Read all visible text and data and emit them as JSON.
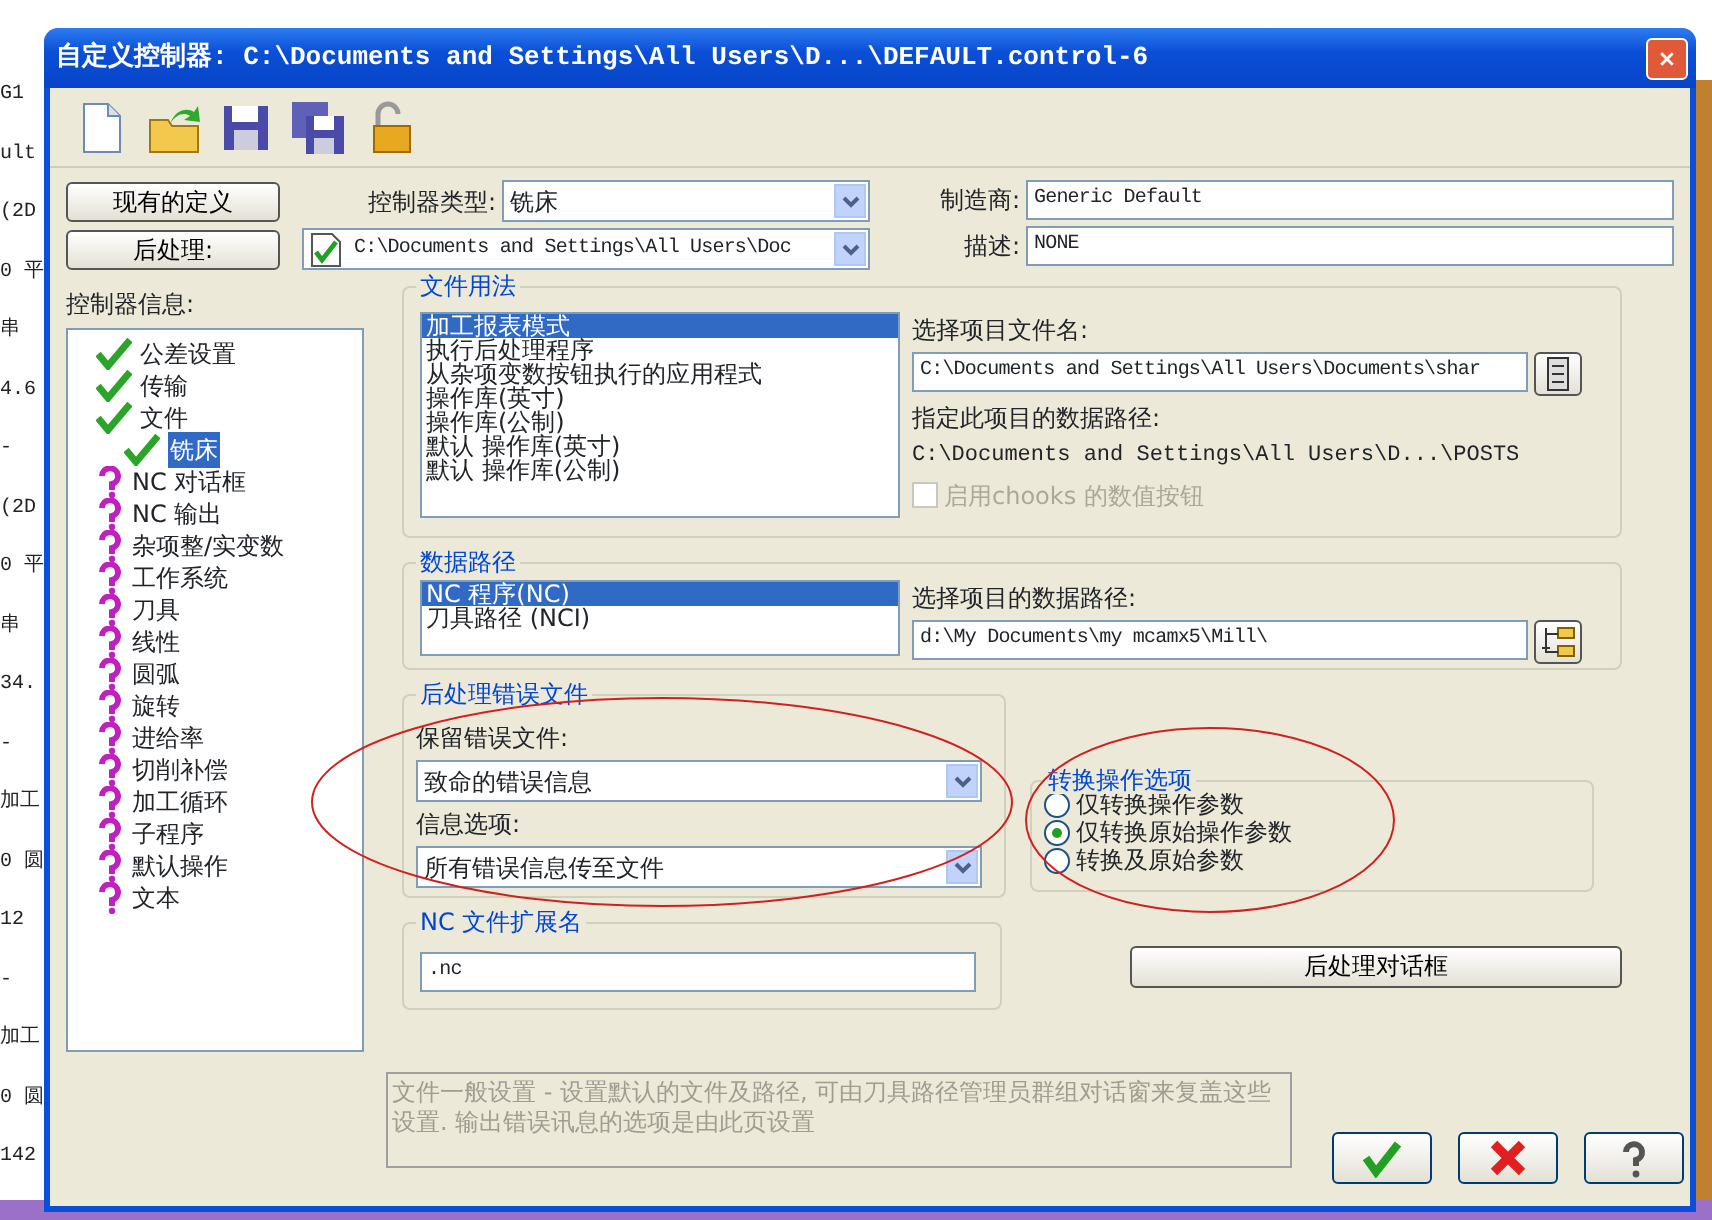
{
  "background_lines": [
    {
      "text": "G1"
    },
    {
      "text": "ult"
    },
    {
      "text": "(2D"
    },
    {
      "text": "0 平"
    },
    {
      "text": "串"
    },
    {
      "text": "4.6"
    },
    {
      "text": "-"
    },
    {
      "text": "(2D"
    },
    {
      "text": "0 平"
    },
    {
      "text": "串"
    },
    {
      "text": "34."
    },
    {
      "text": "-"
    },
    {
      "text": "加工"
    },
    {
      "text": "0 圆"
    },
    {
      "text": "12"
    },
    {
      "text": "-"
    },
    {
      "text": "加工"
    },
    {
      "text": "0 圆"
    },
    {
      "text": "142"
    }
  ],
  "window": {
    "title": "自定义控制器: C:\\Documents and Settings\\All Users\\D...\\DEFAULT.control-6"
  },
  "toolbar": [
    {
      "kind": "new"
    },
    {
      "kind": "open"
    },
    {
      "kind": "save"
    },
    {
      "kind": "saveas"
    },
    {
      "kind": "lock"
    }
  ],
  "existing_button": "现有的定义",
  "post_button": "后处理:",
  "controller_type": {
    "label": "控制器类型:",
    "value": "铣床"
  },
  "post_path": {
    "value": "C:\\Documents and Settings\\All Users\\Doc"
  },
  "manufacturer": {
    "label": "制造商:",
    "value": "Generic Default"
  },
  "description": {
    "label": "描述:",
    "value": "NONE"
  },
  "tree_label": "控制器信息:",
  "tree": [
    {
      "label": "公差设置",
      "kind": "done",
      "selected": false
    },
    {
      "label": "传输",
      "kind": "done",
      "selected": false
    },
    {
      "label": "文件",
      "kind": "done",
      "selected": false,
      "children": [
        {
          "label": "铣床",
          "kind": "done",
          "selected": true
        }
      ]
    },
    {
      "label": "NC 对话框",
      "kind": "todo",
      "selected": false
    },
    {
      "label": "NC 输出",
      "kind": "todo",
      "selected": false
    },
    {
      "label": "杂项整/实变数",
      "kind": "todo",
      "selected": false
    },
    {
      "label": "工作系统",
      "kind": "todo",
      "selected": false
    },
    {
      "label": "刀具",
      "kind": "todo",
      "selected": false
    },
    {
      "label": "线性",
      "kind": "todo",
      "selected": false
    },
    {
      "label": "圆弧",
      "kind": "todo",
      "selected": false
    },
    {
      "label": "旋转",
      "kind": "todo",
      "selected": false
    },
    {
      "label": "进给率",
      "kind": "todo",
      "selected": false
    },
    {
      "label": "切削补偿",
      "kind": "todo",
      "selected": false
    },
    {
      "label": "加工循环",
      "kind": "todo",
      "selected": false
    },
    {
      "label": "子程序",
      "kind": "todo",
      "selected": false
    },
    {
      "label": "默认操作",
      "kind": "todo",
      "selected": false
    },
    {
      "label": "文本",
      "kind": "todo",
      "selected": false
    }
  ],
  "file_usage": {
    "title": "文件用法",
    "items": [
      {
        "label": "加工报表模式",
        "selected": true
      },
      {
        "label": "执行后处理程序",
        "selected": false
      },
      {
        "label": "从杂项变数按钮执行的应用程式",
        "selected": false
      },
      {
        "label": "操作库(英寸)",
        "selected": false
      },
      {
        "label": "操作库(公制)",
        "selected": false
      },
      {
        "label": "默认 操作库(英寸)",
        "selected": false
      },
      {
        "label": "默认 操作库(公制)",
        "selected": false
      }
    ],
    "file_label": "选择项目文件名:",
    "file_value": "C:\\Documents and Settings\\All Users\\Documents\\shar",
    "path_label": "指定此项目的数据路径:",
    "path_value": "C:\\Documents and Settings\\All Users\\D...\\POSTS",
    "chooks": {
      "label": "启用chooks 的数值按钮",
      "checked": false,
      "disabled": true
    }
  },
  "data_path": {
    "title": "数据路径",
    "items": [
      {
        "label": "NC 程序(NC)",
        "selected": true
      },
      {
        "label": "刀具路径 (NCI)",
        "selected": false
      }
    ],
    "label": "选择项目的数据路径:",
    "value": "d:\\My Documents\\my mcamx5\\Mill\\"
  },
  "error_file": {
    "title": "后处理错误文件",
    "keep_label": "保留错误文件:",
    "keep_value": "致命的错误信息",
    "info_label": "信息选项:",
    "info_value": "所有错误信息传至文件"
  },
  "convert": {
    "title": "转换操作选项",
    "options": [
      {
        "label": "仅转换操作参数",
        "selected": false
      },
      {
        "label": "仅转换原始操作参数",
        "selected": true
      },
      {
        "label": "转换及原始参数",
        "selected": false
      }
    ]
  },
  "extension": {
    "title": "NC 文件扩展名",
    "value": ".nc"
  },
  "post_dialog_button": "后处理对话框",
  "hint": "文件一般设置 - 设置默认的文件及路径, 可由刀具路径管理员群组对话窗来复盖这些设置. 输出错误讯息的选项是由此页设置",
  "footer_buttons": [
    {
      "kind": "ok"
    },
    {
      "kind": "cancel"
    },
    {
      "kind": "help"
    }
  ]
}
